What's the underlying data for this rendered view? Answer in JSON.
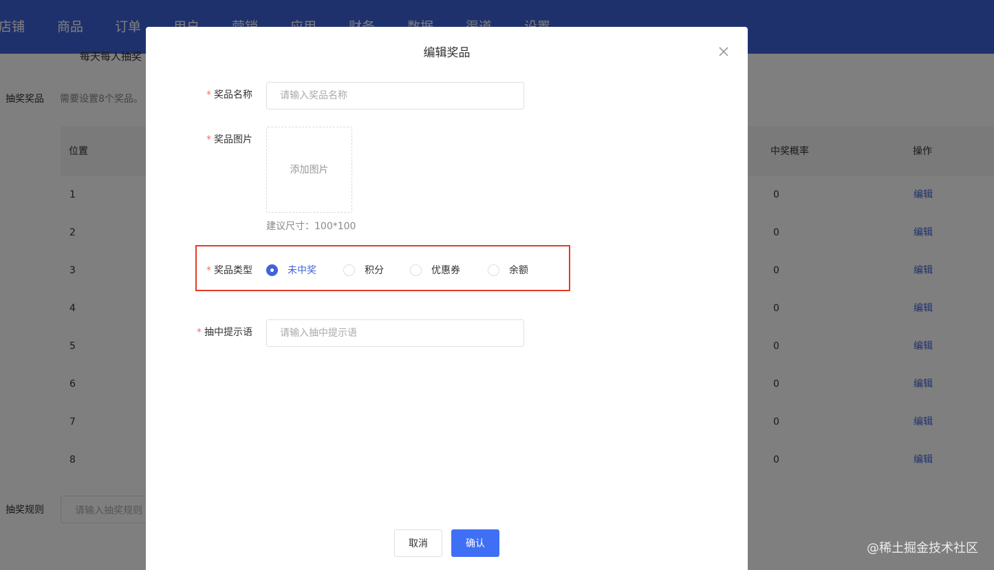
{
  "nav": {
    "items": [
      "店铺",
      "商品",
      "订单",
      "用户",
      "营销",
      "应用",
      "财务",
      "数据",
      "渠道",
      "设置"
    ]
  },
  "background": {
    "daily_text": "每天每人抽奖",
    "prizes_label": "抽奖奖品",
    "prizes_hint": "需要设置8个奖品。",
    "table": {
      "col_position": "位置",
      "col_probability": "中奖概率",
      "col_action": "操作",
      "rows": [
        {
          "position": "1",
          "probability": "0",
          "action": "编辑"
        },
        {
          "position": "2",
          "probability": "0",
          "action": "编辑"
        },
        {
          "position": "3",
          "probability": "0",
          "action": "编辑"
        },
        {
          "position": "4",
          "probability": "0",
          "action": "编辑"
        },
        {
          "position": "5",
          "probability": "0",
          "action": "编辑"
        },
        {
          "position": "6",
          "probability": "0",
          "action": "编辑"
        },
        {
          "position": "7",
          "probability": "0",
          "action": "编辑"
        },
        {
          "position": "8",
          "probability": "0",
          "action": "编辑"
        }
      ]
    },
    "rules_label": "抽奖规则",
    "rules_placeholder": "请输入抽奖规则"
  },
  "modal": {
    "title": "编辑奖品",
    "required_mark": "*",
    "prize_name": {
      "label": "奖品名称",
      "placeholder": "请输入奖品名称",
      "value": ""
    },
    "prize_image": {
      "label": "奖品图片",
      "upload_text": "添加图片",
      "hint": "建议尺寸：100*100"
    },
    "prize_type": {
      "label": "奖品类型",
      "options": [
        {
          "label": "未中奖",
          "checked": true
        },
        {
          "label": "积分",
          "checked": false
        },
        {
          "label": "优惠券",
          "checked": false
        },
        {
          "label": "余额",
          "checked": false
        }
      ]
    },
    "win_message": {
      "label": "抽中提示语",
      "placeholder": "请输入抽中提示语",
      "value": ""
    },
    "cancel_label": "取消",
    "confirm_label": "确认"
  },
  "watermark": "@稀土掘金技术社区",
  "colors": {
    "primary": "#3f63d8",
    "confirm_button": "#3f6ff5",
    "required": "#f56c6c",
    "highlight_border": "#e23a24",
    "overlay": "rgba(0,0,0,0.5)"
  }
}
